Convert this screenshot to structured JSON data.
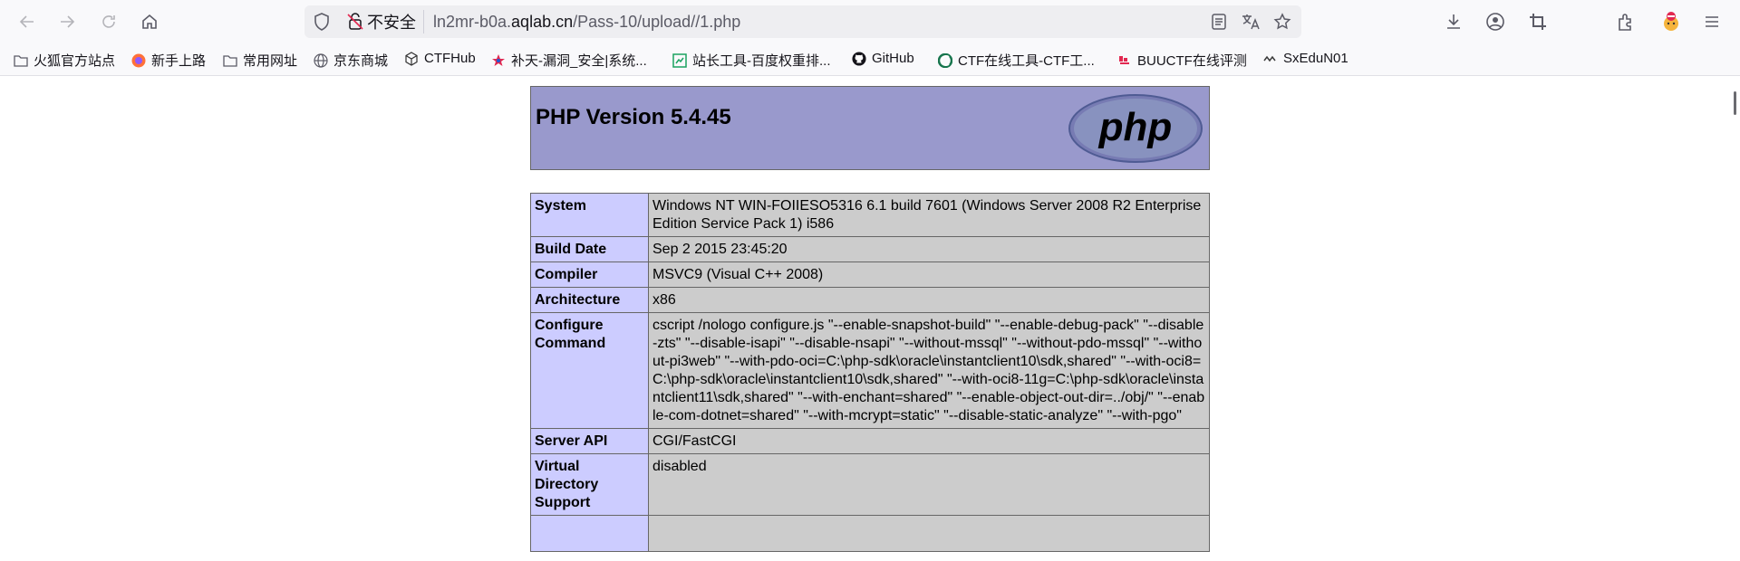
{
  "browser": {
    "insecure_label": "不安全",
    "url_host_prefix": "ln2mr-b0a.",
    "url_host_domain": "aqlab.cn",
    "url_path": "/Pass-10/upload//1.php"
  },
  "bookmarks": [
    {
      "label": "火狐官方站点",
      "icon": "folder-icon"
    },
    {
      "label": "新手上路",
      "icon": "firefox-icon"
    },
    {
      "label": "常用网址",
      "icon": "folder-icon"
    },
    {
      "label": "京东商城",
      "icon": "globe-icon"
    },
    {
      "label": "CTFHub",
      "icon": "cube-icon"
    },
    {
      "label": "补天-漏洞_安全|系统...",
      "icon": "star-icon"
    },
    {
      "label": "站长工具-百度权重排...",
      "icon": "chart-icon"
    },
    {
      "label": "GitHub",
      "icon": "github-icon"
    },
    {
      "label": "CTF在线工具-CTF工...",
      "icon": "ctf-icon"
    },
    {
      "label": "BUUCTF在线评测",
      "icon": "buuctf-icon"
    },
    {
      "label": "SxEduN01",
      "icon": "sx-icon"
    }
  ],
  "phpinfo": {
    "title": "PHP Version 5.4.45",
    "logo_text": "php",
    "rows": [
      {
        "key": "System",
        "value": "Windows NT WIN-FOIIESO5316 6.1 build 7601 (Windows Server 2008 R2 Enterprise Edition Service Pack 1) i586"
      },
      {
        "key": "Build Date",
        "value": "Sep 2 2015 23:45:20"
      },
      {
        "key": "Compiler",
        "value": "MSVC9 (Visual C++ 2008)"
      },
      {
        "key": "Architecture",
        "value": "x86"
      },
      {
        "key": "Configure Command",
        "value": "cscript /nologo configure.js \"--enable-snapshot-build\" \"--enable-debug-pack\" \"--disable-zts\" \"--disable-isapi\" \"--disable-nsapi\" \"--without-mssql\" \"--without-pdo-mssql\" \"--without-pi3web\" \"--with-pdo-oci=C:\\php-sdk\\oracle\\instantclient10\\sdk,shared\" \"--with-oci8=C:\\php-sdk\\oracle\\instantclient10\\sdk,shared\" \"--with-oci8-11g=C:\\php-sdk\\oracle\\instantclient11\\sdk,shared\" \"--with-enchant=shared\" \"--enable-object-out-dir=../obj/\" \"--enable-com-dotnet=shared\" \"--with-mcrypt=static\" \"--disable-static-analyze\" \"--with-pgo\""
      },
      {
        "key": "Server API",
        "value": "CGI/FastCGI"
      },
      {
        "key": "Virtual Directory Support",
        "value": "disabled"
      },
      {
        "key": "",
        "value": ""
      }
    ]
  },
  "colors": {
    "header_bg": "#9999cc",
    "key_bg": "#ccccff",
    "value_bg": "#cccccc"
  }
}
